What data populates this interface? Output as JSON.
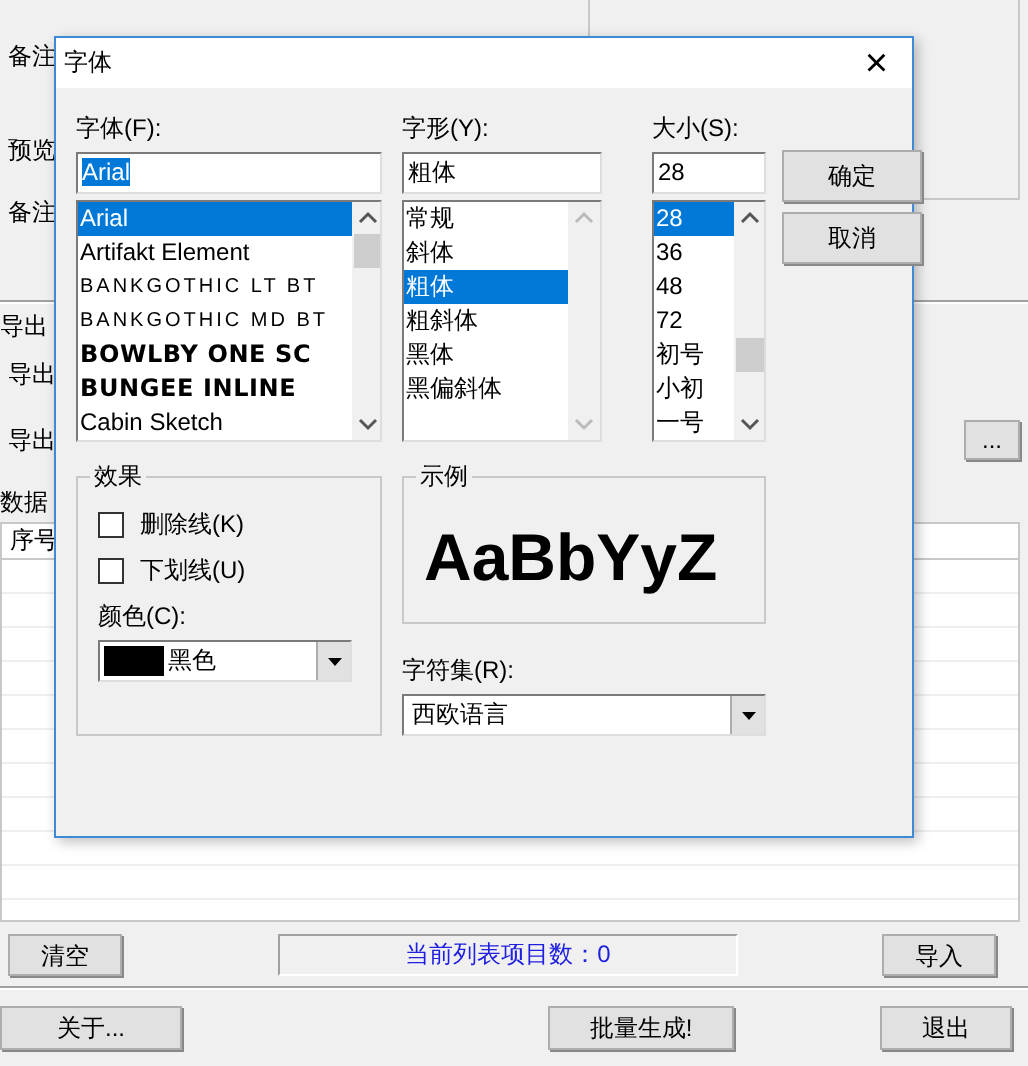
{
  "background": {
    "top_labels": [
      "备注",
      "预览",
      "备注"
    ],
    "export_group": {
      "title": "导出",
      "labels": [
        "导出",
        "导出"
      ],
      "browse_button": "..."
    },
    "data_source": "数据",
    "table": {
      "columns": [
        "序号"
      ]
    },
    "clear_button": "清空",
    "status": "当前列表项目数：0",
    "import_button": "导入",
    "about_button": "关于...",
    "batch_button": "批量生成!",
    "exit_button": "退出"
  },
  "dialog": {
    "title": "字体",
    "close": "×",
    "font": {
      "label": "字体(F):",
      "value": "Arial",
      "items": [
        {
          "label": "Arial",
          "selected": true,
          "kind": "plain"
        },
        {
          "label": "Artifakt Element",
          "selected": false,
          "kind": "plain"
        },
        {
          "label": "BANKGOTHIC LT BT",
          "selected": false,
          "kind": "wide"
        },
        {
          "label": "BANKGOTHIC MD BT",
          "selected": false,
          "kind": "wide"
        },
        {
          "label": "BOWLBY ONE SC",
          "selected": false,
          "kind": "heavy"
        },
        {
          "label": "BUNGEE INLINE",
          "selected": false,
          "kind": "heavy"
        },
        {
          "label": "Cabin Sketch",
          "selected": false,
          "kind": "plain"
        }
      ]
    },
    "style": {
      "label": "字形(Y):",
      "value": "粗体",
      "items": [
        {
          "label": "常规",
          "selected": false
        },
        {
          "label": "斜体",
          "selected": false
        },
        {
          "label": "粗体",
          "selected": true
        },
        {
          "label": "粗斜体",
          "selected": false
        },
        {
          "label": "黑体",
          "selected": false
        },
        {
          "label": "黑偏斜体",
          "selected": false
        }
      ]
    },
    "size": {
      "label": "大小(S):",
      "value": "28",
      "items": [
        {
          "label": "28",
          "selected": true
        },
        {
          "label": "36",
          "selected": false
        },
        {
          "label": "48",
          "selected": false
        },
        {
          "label": "72",
          "selected": false
        },
        {
          "label": "初号",
          "selected": false
        },
        {
          "label": "小初",
          "selected": false
        },
        {
          "label": "一号",
          "selected": false
        }
      ]
    },
    "buttons": [
      "确定",
      "取消"
    ],
    "effects": {
      "title": "效果",
      "options": [
        {
          "label": "删除线(K)",
          "checked": false
        },
        {
          "label": "下划线(U)",
          "checked": false
        }
      ],
      "color_label": "颜色(C):",
      "color": {
        "label": "黑色",
        "color": "#000000"
      }
    },
    "sample": {
      "title": "示例",
      "text": "AaBbYyZ"
    },
    "charset": {
      "label": "字符集(R):",
      "value": "西欧语言"
    }
  }
}
